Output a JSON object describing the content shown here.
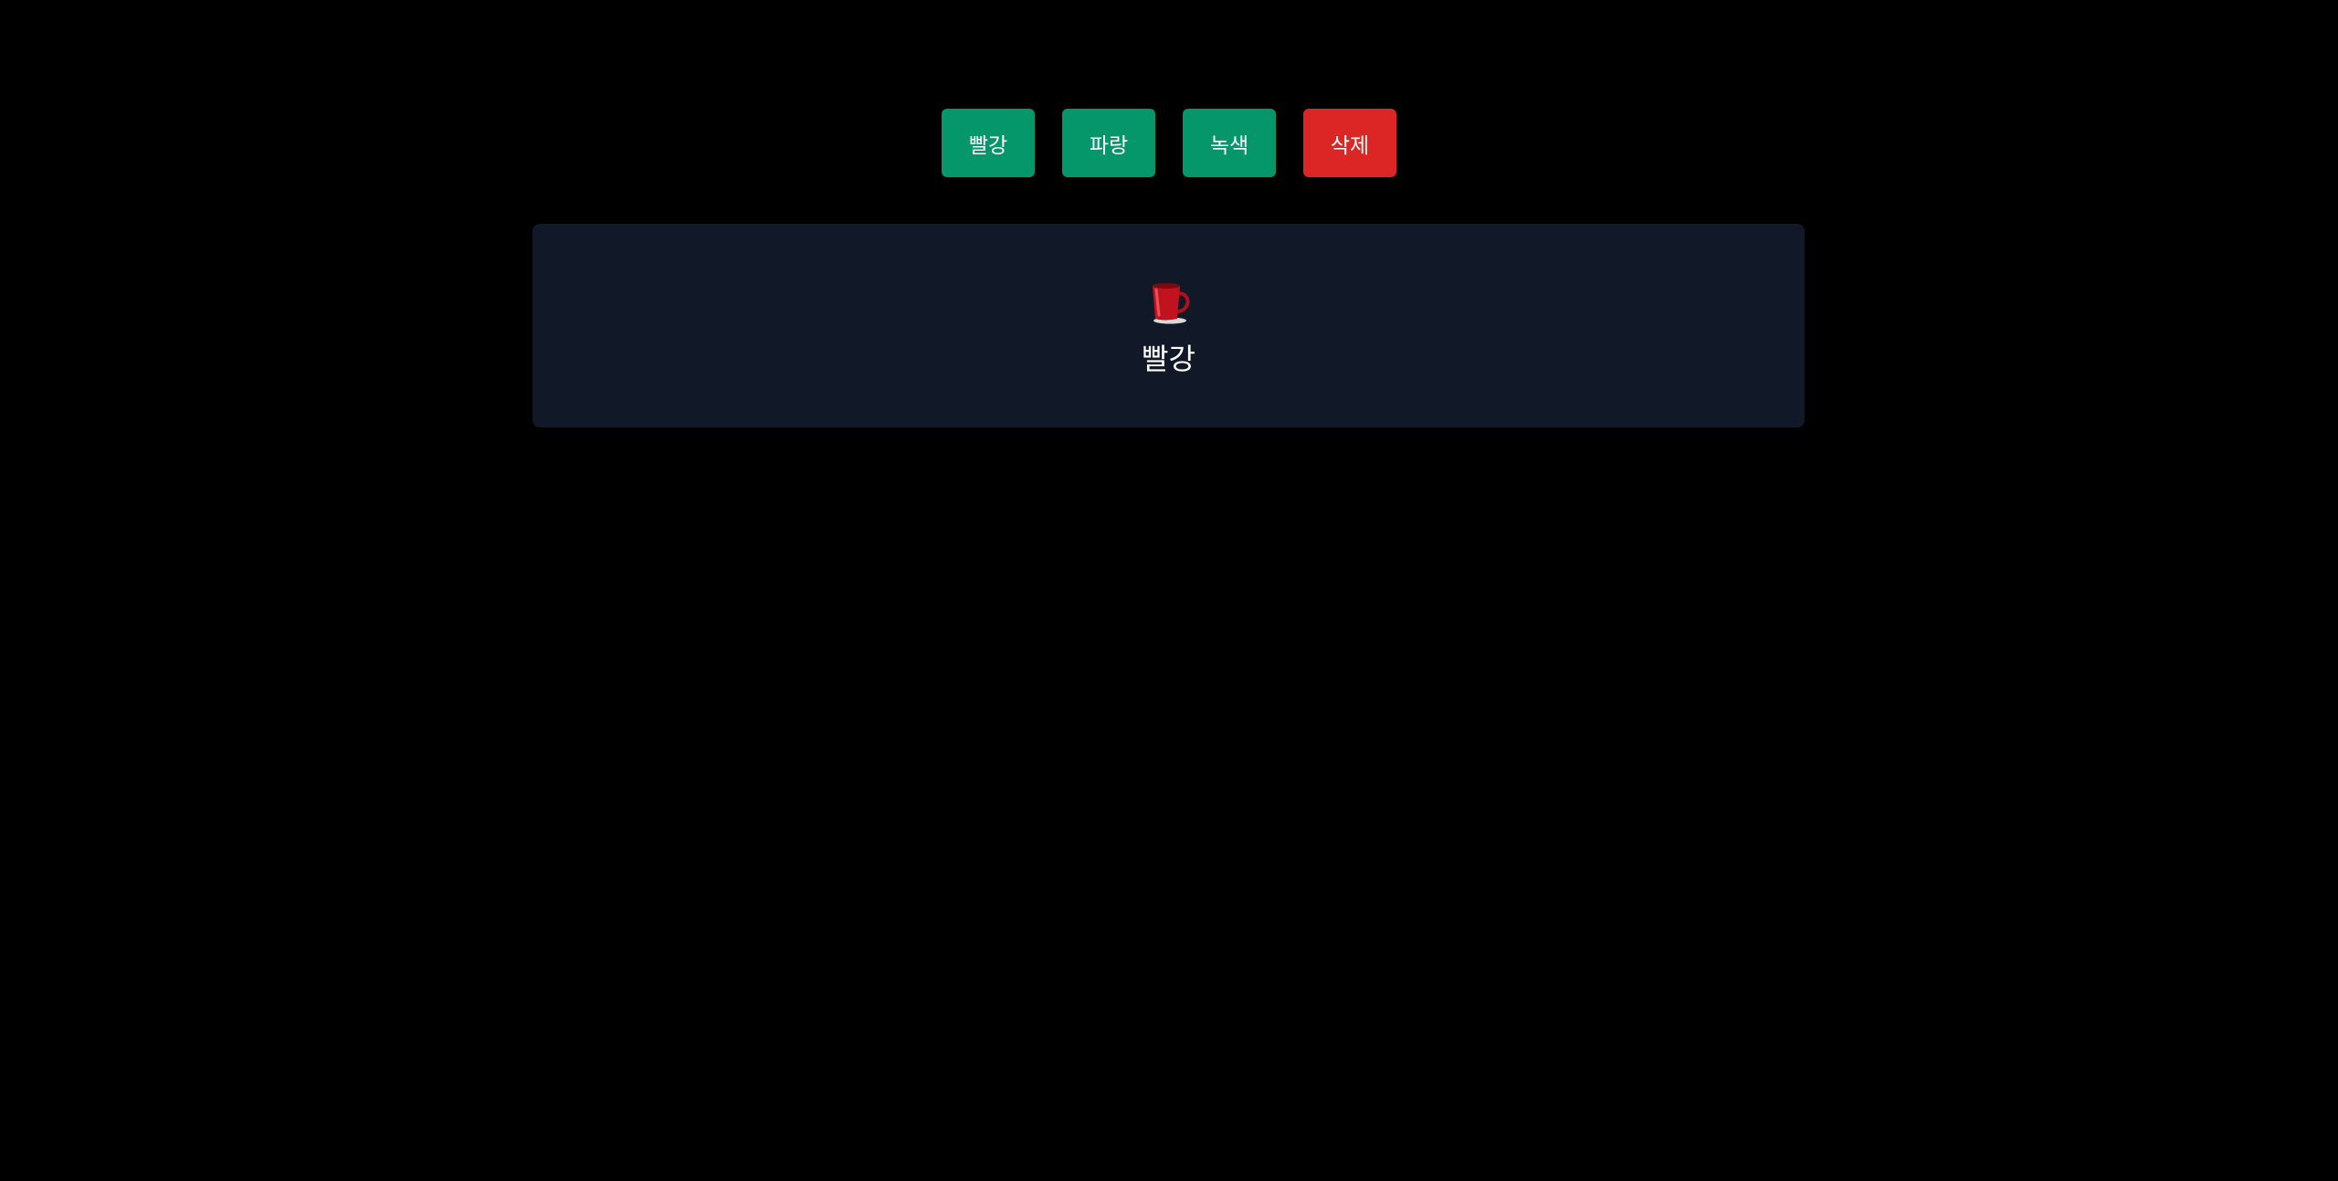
{
  "toolbar": {
    "buttons": [
      {
        "label": "빨강",
        "color": "#059669"
      },
      {
        "label": "파랑",
        "color": "#059669"
      },
      {
        "label": "녹색",
        "color": "#059669"
      },
      {
        "label": "삭제",
        "color": "#dc2626"
      }
    ]
  },
  "card": {
    "icon": "cup-icon",
    "icon_color": "#c1121f",
    "label": "빨강",
    "background": "#111827"
  },
  "page": {
    "background": "#000000"
  }
}
